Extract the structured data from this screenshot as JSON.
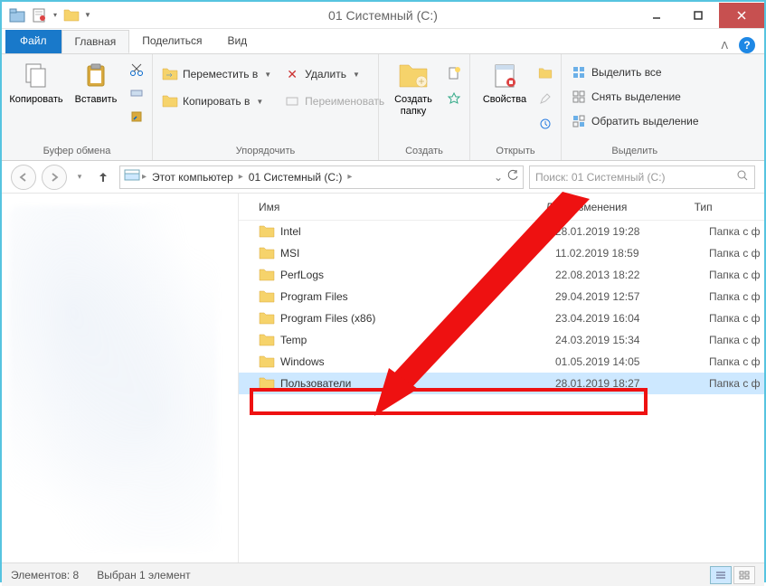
{
  "window": {
    "title": "01 Системный (C:)"
  },
  "ribbon": {
    "file_tab": "Файл",
    "tabs": [
      "Главная",
      "Поделиться",
      "Вид"
    ],
    "groups": {
      "clipboard": {
        "label": "Буфер обмена",
        "copy": "Копировать",
        "paste": "Вставить"
      },
      "organize": {
        "label": "Упорядочить",
        "move_to": "Переместить в",
        "copy_to": "Копировать в",
        "delete": "Удалить",
        "rename": "Переименовать"
      },
      "create": {
        "label": "Создать",
        "new_folder": "Создать\nпапку"
      },
      "open": {
        "label": "Открыть",
        "properties": "Свойства"
      },
      "select": {
        "label": "Выделить",
        "select_all": "Выделить все",
        "select_none": "Снять выделение",
        "invert": "Обратить выделение"
      }
    }
  },
  "address": {
    "segments": [
      "Этот компьютер",
      "01 Системный (C:)"
    ],
    "search_placeholder": "Поиск: 01 Системный (C:)"
  },
  "columns": {
    "name": "Имя",
    "date": "Дата изменения",
    "type": "Тип"
  },
  "files": [
    {
      "name": "Intel",
      "date": "28.01.2019 19:28",
      "type": "Папка с ф",
      "selected": false
    },
    {
      "name": "MSI",
      "date": "11.02.2019 18:59",
      "type": "Папка с ф",
      "selected": false
    },
    {
      "name": "PerfLogs",
      "date": "22.08.2013 18:22",
      "type": "Папка с ф",
      "selected": false
    },
    {
      "name": "Program Files",
      "date": "29.04.2019 12:57",
      "type": "Папка с ф",
      "selected": false
    },
    {
      "name": "Program Files (x86)",
      "date": "23.04.2019 16:04",
      "type": "Папка с ф",
      "selected": false
    },
    {
      "name": "Temp",
      "date": "24.03.2019 15:34",
      "type": "Папка с ф",
      "selected": false
    },
    {
      "name": "Windows",
      "date": "01.05.2019 14:05",
      "type": "Папка с ф",
      "selected": false
    },
    {
      "name": "Пользователи",
      "date": "28.01.2019 18:27",
      "type": "Папка с ф",
      "selected": true
    }
  ],
  "status": {
    "items": "Элементов: 8",
    "selected": "Выбран 1 элемент"
  }
}
